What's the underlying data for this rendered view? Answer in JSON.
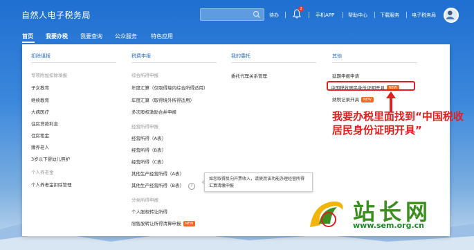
{
  "header": {
    "title": "自然人电子税务局",
    "search_placeholder": "",
    "links": [
      "待办",
      "手机APP",
      "帮助中心",
      "下载服务",
      "电子税务局"
    ],
    "badge_count": "2"
  },
  "nav": {
    "items": [
      "首页",
      "我要办税",
      "我要查询",
      "公众服务",
      "特色应用"
    ]
  },
  "columns": [
    {
      "title": "扣除填报",
      "groups": [
        {
          "sub": "专项附加扣除填报",
          "items": [
            "子女教育",
            "继续教育",
            "大病医疗",
            "住房贷款利息",
            "住房租金",
            "赡养老人",
            "3岁以下婴幼儿照护"
          ]
        },
        {
          "sub": "个人养老金",
          "items": [
            "个人养老金扣除管理"
          ]
        }
      ]
    },
    {
      "title": "税费申报",
      "groups": [
        {
          "sub": "综合所得申报",
          "items": [
            "年度汇算（仅取得境内综合所得适用）",
            "年度汇算（取得境外所得适用）",
            "多次股权激励合并申报"
          ]
        },
        {
          "sub": "经营所得申报",
          "items": [
            "经营所得（A表）",
            "经营所得（B表）",
            "经营所得（C表）",
            "其他生产经营所得（A表）",
            "其他生产经营所得（B表）"
          ]
        },
        {
          "sub": "分类所得申报",
          "items": [
            "个人股权转让所得",
            "限售股转让所得清算申报"
          ]
        }
      ]
    },
    {
      "title": "我的委托",
      "groups": [
        {
          "sub": "",
          "items": [
            "委托代理关系管理"
          ]
        }
      ]
    },
    {
      "title": "其他",
      "groups": [
        {
          "sub": "",
          "items": [
            "延期申报申请",
            "中国税收居民身份证明开具",
            "纳税记录开具"
          ]
        }
      ]
    }
  ],
  "new_label": "NEW",
  "tooltip": "如您取得反向开票收入，请使用该功能办理经营所得汇算清缴申报",
  "annotation": "我要办税里面找到“中国税收居民身份证明开具”",
  "watermark": {
    "text": "站长网",
    "url": "www.sem.org.cn"
  },
  "colors": {
    "header_blue": "#1f6fd1",
    "link_blue": "#2f6ec7",
    "new_orange": "#f26b21",
    "annot_red": "#e02020",
    "wm_green": "#3a8f1e"
  },
  "icons": {
    "search": "search-icon",
    "bell": "bell-icon",
    "avatar": "avatar-icon",
    "help": "help-icon"
  }
}
